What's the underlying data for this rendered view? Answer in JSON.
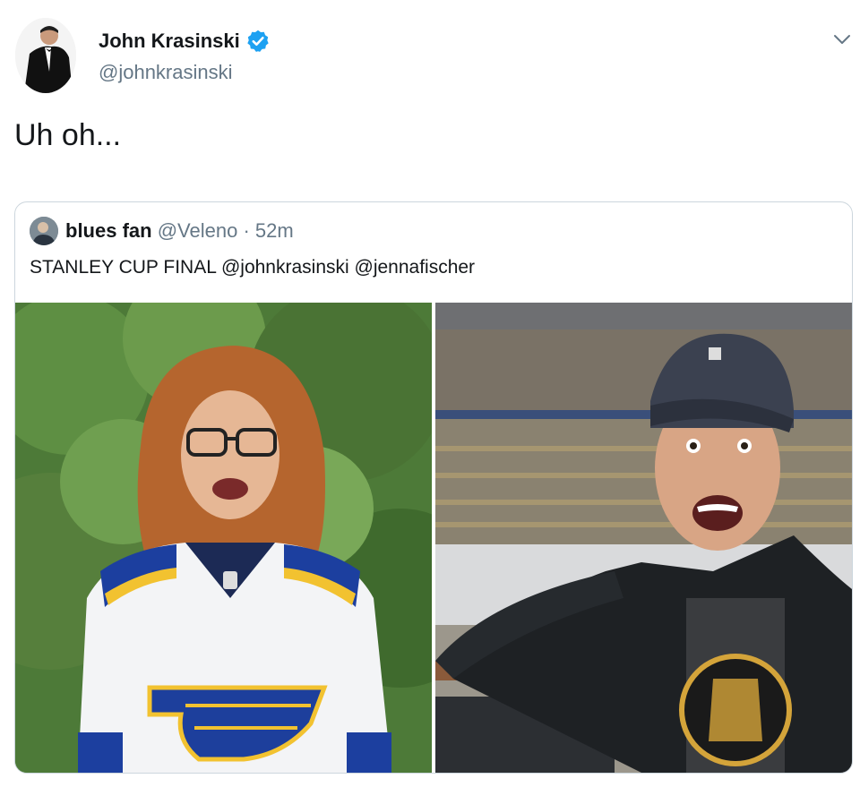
{
  "tweet": {
    "author": {
      "display_name": "John Krasinski",
      "handle": "@johnkrasinski",
      "verified": true,
      "avatar_icon": "person-in-tuxedo-avatar"
    },
    "text": "Uh oh...",
    "menu_icon": "chevron-down-icon"
  },
  "quoted_tweet": {
    "author": {
      "display_name": "blues fan",
      "handle": "@Veleno",
      "separator": "·",
      "time": "52m"
    },
    "text": "STANLEY CUP FINAL @johnkrasinski @jennafischer",
    "media": [
      {
        "description_icon": "woman-in-blues-jersey-photo"
      },
      {
        "description_icon": "man-in-bruins-shirt-at-arena-photo"
      }
    ]
  },
  "colors": {
    "verified_blue": "#1da1f2",
    "secondary_text": "#657786",
    "border": "#ccd6dd"
  }
}
